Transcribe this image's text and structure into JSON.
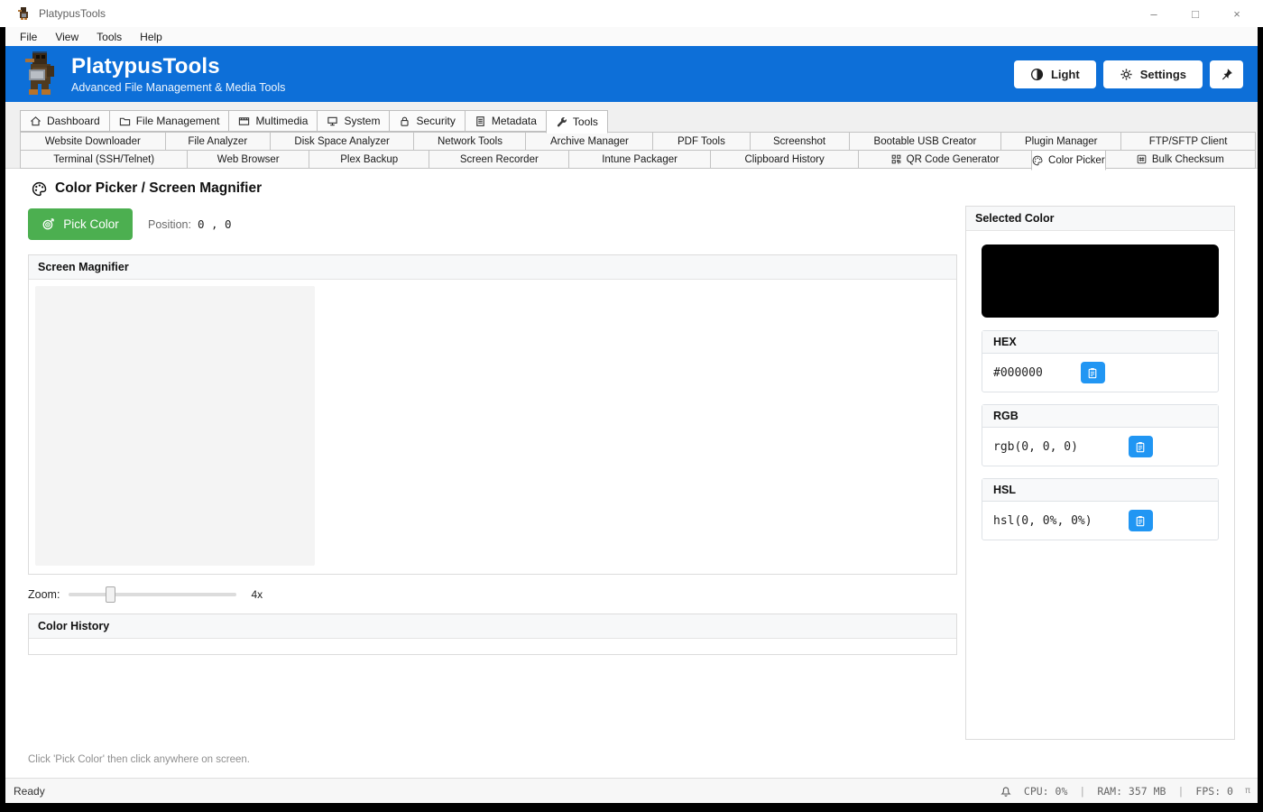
{
  "window": {
    "title": "PlatypusTools",
    "controls": {
      "minimize": "–",
      "maximize": "□",
      "close": "×"
    }
  },
  "menu": {
    "items": [
      "File",
      "View",
      "Tools",
      "Help"
    ]
  },
  "header": {
    "title": "PlatypusTools",
    "subtitle": "Advanced File Management & Media Tools",
    "light_button": "Light",
    "settings_button": "Settings",
    "pin_icon": "pin-icon"
  },
  "tabs": {
    "main": [
      {
        "label": "Dashboard",
        "icon": "home-icon",
        "selected": false
      },
      {
        "label": "File Management",
        "icon": "folder-icon",
        "selected": false
      },
      {
        "label": "Multimedia",
        "icon": "film-icon",
        "selected": false
      },
      {
        "label": "System",
        "icon": "monitor-icon",
        "selected": false
      },
      {
        "label": "Security",
        "icon": "lock-icon",
        "selected": false
      },
      {
        "label": "Metadata",
        "icon": "document-icon",
        "selected": false
      },
      {
        "label": "Tools",
        "icon": "wrench-icon",
        "selected": true
      }
    ],
    "row1": [
      {
        "label": "Website Downloader"
      },
      {
        "label": "File Analyzer"
      },
      {
        "label": "Disk Space Analyzer"
      },
      {
        "label": "Network Tools"
      },
      {
        "label": "Archive Manager"
      },
      {
        "label": "PDF Tools"
      },
      {
        "label": "Screenshot"
      },
      {
        "label": "Bootable USB Creator"
      },
      {
        "label": "Plugin Manager"
      },
      {
        "label": "FTP/SFTP Client"
      }
    ],
    "row2": [
      {
        "label": "Terminal (SSH/Telnet)"
      },
      {
        "label": "Web Browser"
      },
      {
        "label": "Plex Backup"
      },
      {
        "label": "Screen Recorder"
      },
      {
        "label": "Intune Packager"
      },
      {
        "label": "Clipboard History"
      },
      {
        "label": "QR Code Generator",
        "icon": "qr-code-icon"
      },
      {
        "label": "Color Picker",
        "icon": "palette-icon",
        "selected": true
      },
      {
        "label": "Bulk Checksum",
        "icon": "checksum-icon"
      }
    ]
  },
  "picker": {
    "heading": "Color Picker / Screen Magnifier",
    "pick_color_button": "Pick Color",
    "position_label": "Position:",
    "position_value": "0 , 0",
    "magnifier_title": "Screen Magnifier",
    "zoom_label": "Zoom:",
    "zoom_value": "4x",
    "zoom_percent": 22,
    "history_title": "Color History",
    "hint": "Click 'Pick Color' then click anywhere on screen."
  },
  "selected_color": {
    "title": "Selected Color",
    "swatch_color": "#000000",
    "cards": [
      {
        "label": "HEX",
        "value": "#000000"
      },
      {
        "label": "RGB",
        "value": "rgb(0, 0, 0)"
      },
      {
        "label": "HSL",
        "value": "hsl(0, 0%, 0%)"
      }
    ]
  },
  "status": {
    "ready": "Ready",
    "cpu": "CPU: 0%",
    "sep": "|",
    "ram": "RAM: 357 MB",
    "fps": "FPS: 0",
    "corner": "π"
  },
  "colors": {
    "header_blue": "#0d6fd8",
    "accent_green": "#4caf50",
    "copy_blue": "#2196f3",
    "swatch": "#000000"
  }
}
